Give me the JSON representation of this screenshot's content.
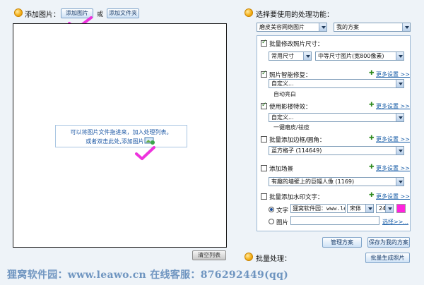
{
  "left": {
    "title": "添加图片：",
    "add_image_btn": "添加图片",
    "or_text": "或",
    "add_folder_btn": "添加文件夹",
    "hint_line1": "可以将图片文件拖进来，加入处理列表。",
    "hint_line2": "或者双击此处,添加图片",
    "clear_list_btn": "清空列表"
  },
  "right": {
    "title": "选择要使用的处理功能：",
    "template_select": "磨皮美容网络图片",
    "scheme_select": "我的方案",
    "resize": {
      "label": "批量修改照片尺寸：",
      "checked": true,
      "mode": "常用尺寸",
      "size": "中等尺寸图片(宽800像素)"
    },
    "repair": {
      "label": "照片智能修复：",
      "checked": true,
      "more": "更多设置 >>",
      "select": "自定义...",
      "sub": "自动亮白"
    },
    "effect": {
      "label": "使用影楼特效：",
      "checked": true,
      "more": "更多设置 >>",
      "select": "自定义...",
      "sub": "一键磨皮/祛痘"
    },
    "border": {
      "label": "批量添加边框/圆角：",
      "checked": false,
      "more": "更多设置 >>",
      "select": "蓝方格子 (114649)"
    },
    "scene": {
      "label": "添加场景",
      "checked": false,
      "more": "更多设置 >>",
      "select": "有趣的墙壁上的巨幅人像 (1169)"
    },
    "watermark": {
      "label": "批量添加水印文字：",
      "checked": false,
      "more": "更多设置 >>",
      "text_radio": "文字",
      "text_value": "狸窝软件园：www.leaw",
      "font": "宋体",
      "size": "24",
      "color": "#ff22dd",
      "image_radio": "图片",
      "browse": "选择>>..."
    },
    "manage_btn": "管理方案",
    "save_btn": "保存为我的方案",
    "batch_title": "批量处理：",
    "batch_btn": "批量生成照片"
  },
  "footer": "狸窝软件园：www.leawo.cn  在线客服：876292449(qq)"
}
